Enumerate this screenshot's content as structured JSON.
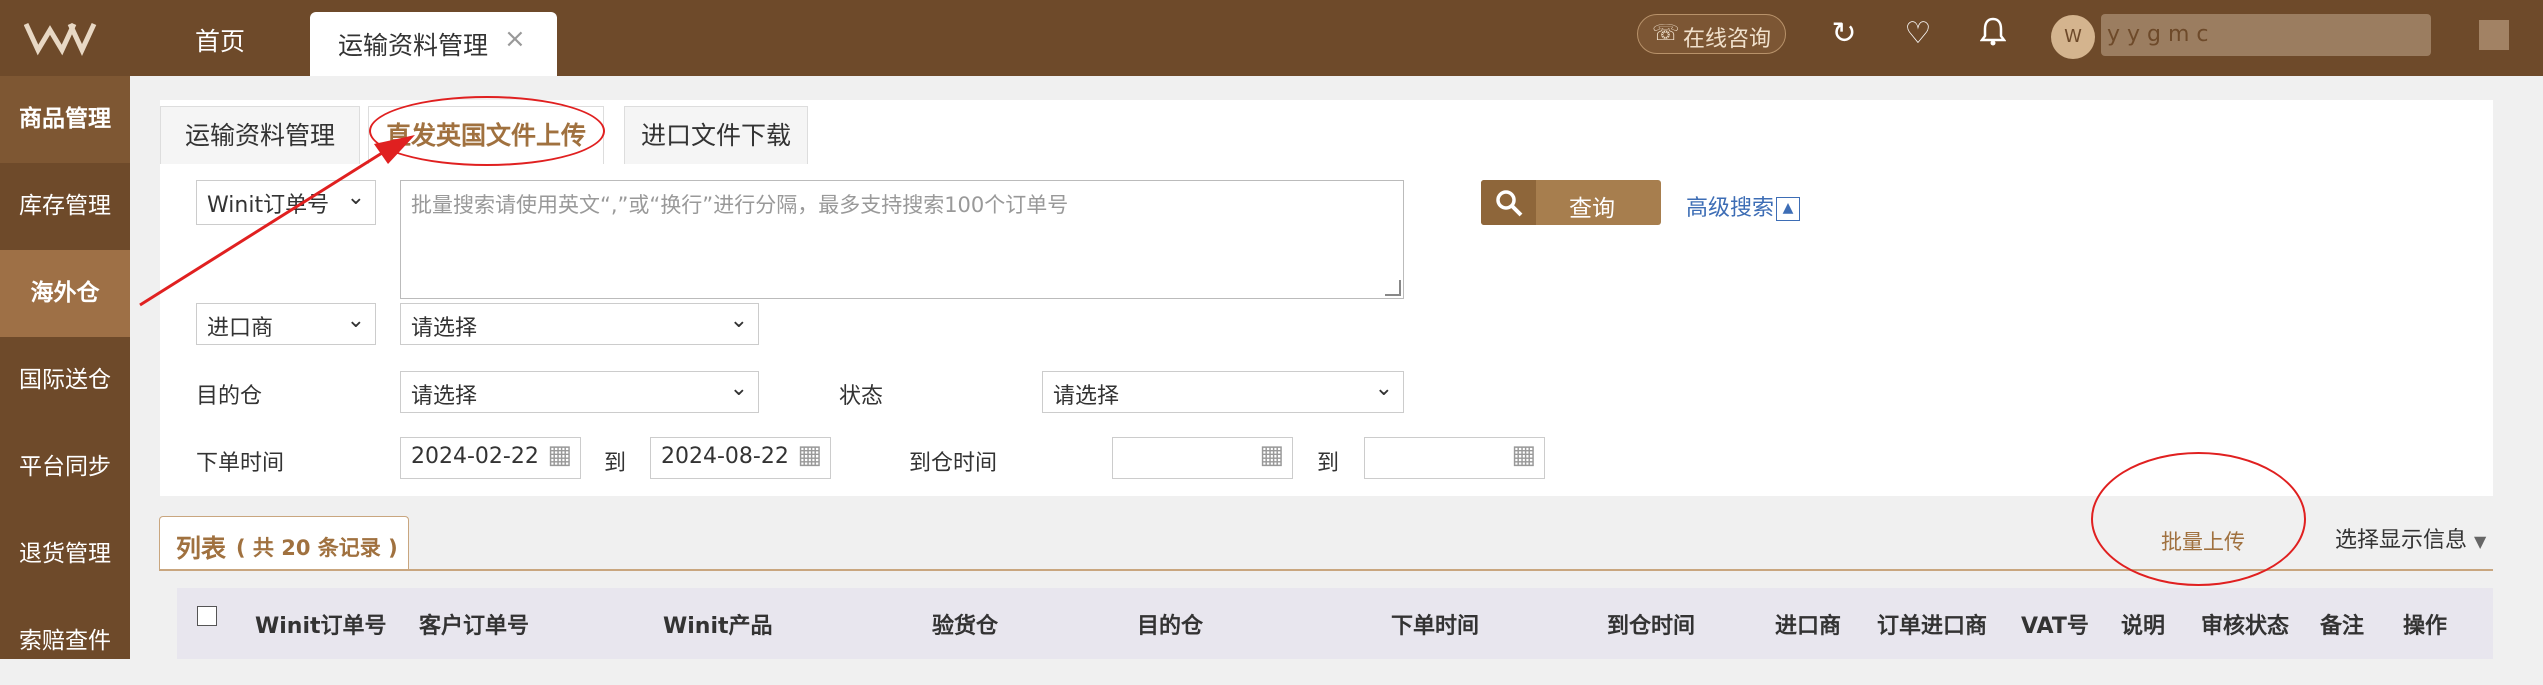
{
  "topbar": {
    "logo_icon": "winit-logo",
    "tabs": [
      {
        "label": "首页"
      },
      {
        "label": "运输资料管理",
        "close": "×"
      }
    ],
    "consult_label": "在线咨询",
    "username": "y    y    g            m  c"
  },
  "sidebar": {
    "items": [
      {
        "label": "商品管理"
      },
      {
        "label": "库存管理"
      },
      {
        "label": "海外仓",
        "selected": true
      },
      {
        "label": "国际送仓"
      },
      {
        "label": "平台同步"
      },
      {
        "label": "退货管理"
      },
      {
        "label": "索赔查件"
      }
    ]
  },
  "subtabs": [
    {
      "label": "运输资料管理"
    },
    {
      "label": "直发英国文件上传",
      "active": true
    },
    {
      "label": "进口文件下载"
    }
  ],
  "search": {
    "type_select": "Winit订单号",
    "textarea_placeholder": "批量搜索请使用英文“,”或“换行”进行分隔，最多支持搜索100个订单号",
    "query_label": "查询",
    "advanced_label": "高级搜索",
    "advanced_toggle": "▲",
    "importer_select": "进口商",
    "importer_value": "请选择",
    "dest_label": "目的仓",
    "dest_value": "请选择",
    "status_label": "状态",
    "status_value": "请选择",
    "order_time_label": "下单时间",
    "order_time_from": "2024-02-22",
    "to_label": "到",
    "order_time_to": "2024-08-22",
    "arrive_time_label": "到仓时间",
    "arrive_from": "",
    "arrive_to": ""
  },
  "list": {
    "title": "列表",
    "count_text": "( 共 20 条记录 )",
    "batch_upload": "批量上传",
    "show_info": "选择显示信息",
    "columns": [
      "Winit订单号",
      "客户订单号",
      "Winit产品",
      "验货仓",
      "目的仓",
      "下单时间",
      "到仓时间",
      "进口商",
      "订单进口商",
      "VAT号",
      "说明",
      "审核状态",
      "备注",
      "操作"
    ]
  },
  "colors": {
    "brand": "#6e4a2a",
    "accent": "#a0713f",
    "annotation": "#e02020"
  }
}
